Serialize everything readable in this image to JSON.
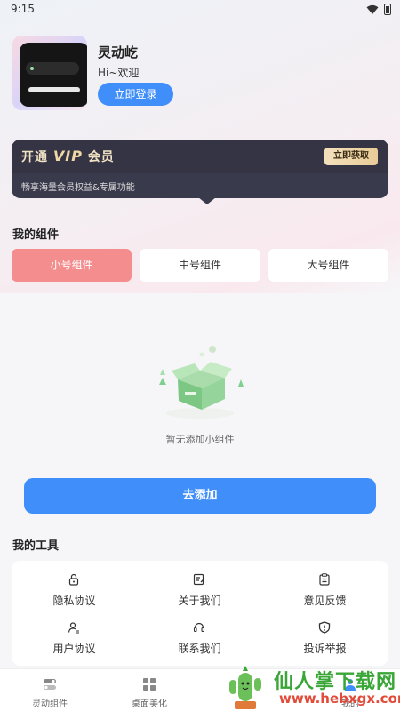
{
  "status_bar": {
    "time": "9:15"
  },
  "profile": {
    "app_name": "灵动屹",
    "greeting": "Hi~欢迎",
    "login_label": "立即登录"
  },
  "vip": {
    "title_prefix": "开通",
    "title_vip": "VIP",
    "title_suffix": "会员",
    "button_label": "立即获取",
    "subtitle": "畅享海量会员权益&专属功能"
  },
  "widgets": {
    "section_title": "我的组件",
    "tabs": [
      {
        "label": "小号组件",
        "active": true
      },
      {
        "label": "中号组件",
        "active": false
      },
      {
        "label": "大号组件",
        "active": false
      }
    ],
    "empty_text": "暂无添加小组件",
    "add_label": "去添加"
  },
  "tools": {
    "section_title": "我的工具",
    "items": [
      {
        "label": "隐私协议",
        "icon": "lock-icon"
      },
      {
        "label": "关于我们",
        "icon": "edit-note-icon"
      },
      {
        "label": "意见反馈",
        "icon": "clipboard-icon"
      },
      {
        "label": "用户协议",
        "icon": "user-doc-icon"
      },
      {
        "label": "联系我们",
        "icon": "headset-icon"
      },
      {
        "label": "投诉举报",
        "icon": "shield-alert-icon"
      }
    ]
  },
  "bottom_nav": {
    "items": [
      {
        "label": "灵动组件",
        "icon": "toggle-icon"
      },
      {
        "label": "桌面美化",
        "icon": "grid-icon"
      },
      {
        "label": "我的",
        "icon": "person-icon"
      }
    ]
  },
  "watermark": {
    "text": "仙人掌下载网",
    "url": "www.hebxgx.com"
  },
  "colors": {
    "accent": "#3f8efa",
    "active_tab": "#f48e8e",
    "vip_bg": "#3a3a4d",
    "vip_gold": "#f0d8a6"
  }
}
